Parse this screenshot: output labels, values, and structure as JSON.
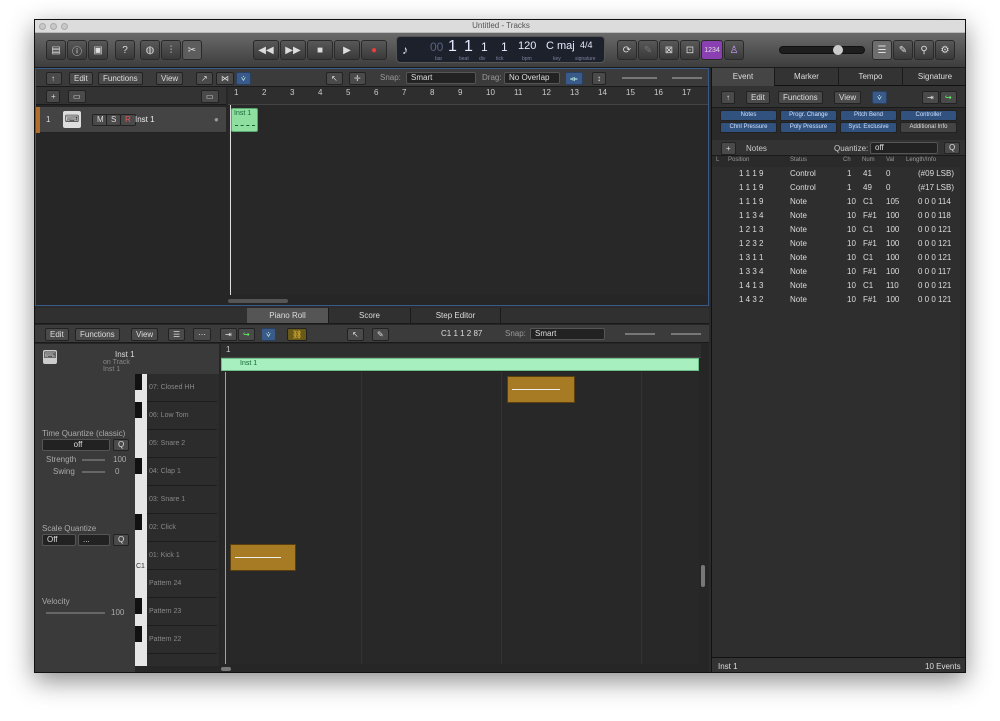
{
  "window": {
    "title": "Untitled - Tracks"
  },
  "lcd": {
    "bar": "1",
    "beat": "1",
    "div": "1",
    "tick": "1",
    "bar_label": "bar",
    "beat_label": "beat",
    "div_label": "div",
    "tick_label": "tick",
    "tempo": "120",
    "tempo_label": "bpm",
    "key": "C maj",
    "key_label": "key",
    "signature": "4/4",
    "signature_label": "signature"
  },
  "toolbar_icons": [
    "library-icon",
    "info-icon",
    "toolbar-icon",
    "help-icon",
    "smart-controls-icon",
    "mixer-icon",
    "editors-icon"
  ],
  "transport": {
    "rewind": "◀◀",
    "forward": "▶▶",
    "stop": "■",
    "play": "▶",
    "record": "●"
  },
  "ctrl_right": {
    "count_in": "1234"
  },
  "tracks_area": {
    "menus": [
      "Edit",
      "Functions",
      "View"
    ],
    "snap_label": "Snap:",
    "snap_value": "Smart",
    "drag_label": "Drag:",
    "drag_value": "No Overlap",
    "ruler": [
      "1",
      "2",
      "3",
      "4",
      "5",
      "6",
      "7",
      "8",
      "9",
      "10",
      "11",
      "12",
      "13",
      "14",
      "15",
      "16",
      "17"
    ],
    "track": {
      "number": "1",
      "mute": "M",
      "solo": "S",
      "record": "R",
      "name": "Inst 1"
    },
    "region": {
      "name": "Inst 1"
    }
  },
  "editor": {
    "tabs": [
      "Piano Roll",
      "Score",
      "Step Editor"
    ],
    "menus": [
      "Edit",
      "Functions",
      "View"
    ],
    "position": "C1  1 1 2 87",
    "snap_label": "Snap:",
    "snap_value": "Smart",
    "region_name": "Inst 1",
    "region_track": "on Track Inst 1",
    "time_quantize_label": "Time Quantize (classic)",
    "time_quantize_value": "off",
    "q": "Q",
    "strength_label": "Strength",
    "strength_value": "100",
    "swing_label": "Swing",
    "swing_value": "0",
    "scale_quantize_label": "Scale Quantize",
    "scale_value": "Off",
    "scale_type": "...",
    "velocity_label": "Velocity",
    "velocity_value": "100",
    "c1_label": "C1",
    "ruler_start": "1",
    "region_label": "Inst 1",
    "keys": [
      "07: Closed HH",
      "06: Low Tom",
      "05: Snare 2",
      "04: Clap 1",
      "03: Snare 1",
      "02: Click",
      "01: Kick 1",
      "Pattern 24",
      "Pattern 23",
      "Pattern 22"
    ]
  },
  "event_list": {
    "tabs": [
      "Event",
      "Marker",
      "Tempo",
      "Signature"
    ],
    "menus": [
      "Edit",
      "Functions",
      "View"
    ],
    "filters": [
      "Notes",
      "Progr. Change",
      "Pitch Bend",
      "Controller",
      "Chnl Pressure",
      "Poly Pressure",
      "Syst. Exclusive",
      "Additional Info"
    ],
    "create_label": "Notes",
    "quantize_label": "Quantize:",
    "quantize_value": "off",
    "q": "Q",
    "columns": [
      "L",
      "Position",
      "Status",
      "Ch",
      "Num",
      "Val",
      "Length/Info"
    ],
    "rows": [
      {
        "position": "1 1 1     9",
        "status": "Control",
        "ch": "1",
        "num": "41",
        "val": "0",
        "info": "(#09 LSB)"
      },
      {
        "position": "1 1 1     9",
        "status": "Control",
        "ch": "1",
        "num": "49",
        "val": "0",
        "info": "(#17 LSB)"
      },
      {
        "position": "1 1 1     9",
        "status": "Note",
        "ch": "10",
        "num": "C1",
        "val": "105",
        "info": "0 0 0 114"
      },
      {
        "position": "1 1 3     4",
        "status": "Note",
        "ch": "10",
        "num": "F#1",
        "val": "100",
        "info": "0 0 0 118"
      },
      {
        "position": "1 2 1     3",
        "status": "Note",
        "ch": "10",
        "num": "C1",
        "val": "100",
        "info": "0 0 0 121"
      },
      {
        "position": "1 2 3     2",
        "status": "Note",
        "ch": "10",
        "num": "F#1",
        "val": "100",
        "info": "0 0 0 121"
      },
      {
        "position": "1 3 1     1",
        "status": "Note",
        "ch": "10",
        "num": "C1",
        "val": "100",
        "info": "0 0 0 121"
      },
      {
        "position": "1 3 3     4",
        "status": "Note",
        "ch": "10",
        "num": "F#1",
        "val": "100",
        "info": "0 0 0 117"
      },
      {
        "position": "1 4 1     3",
        "status": "Note",
        "ch": "10",
        "num": "C1",
        "val": "110",
        "info": "0 0 0 121"
      },
      {
        "position": "1 4 3     2",
        "status": "Note",
        "ch": "10",
        "num": "F#1",
        "val": "100",
        "info": "0 0 0 121"
      }
    ],
    "footer_name": "Inst 1",
    "footer_count": "10 Events"
  },
  "colors": {
    "region_green": "#8fe0a0",
    "note_gold": "#a77a24",
    "accent_blue": "#3a5a8a",
    "count_in_purple": "#8a3fb3"
  }
}
